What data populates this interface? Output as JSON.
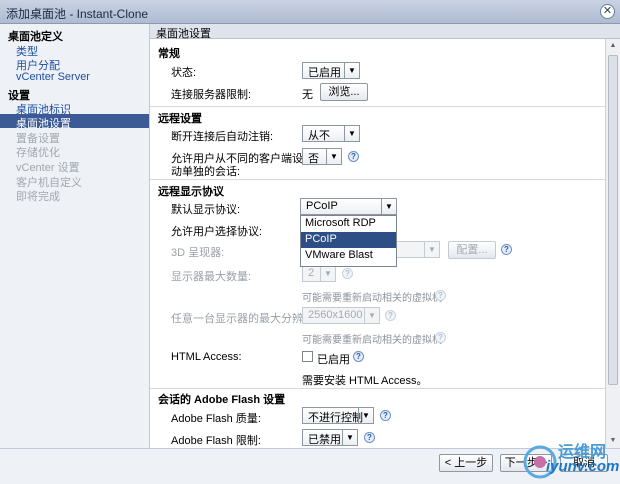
{
  "window": {
    "title": "添加桌面池 - Instant-Clone",
    "close_glyph": "✕"
  },
  "nav": {
    "group1": "桌面池定义",
    "type": "类型",
    "user_assignment": "用户分配",
    "vcenter_server": "vCenter Server",
    "group2": "设置",
    "pool_id": "桌面池标识",
    "pool_settings": "桌面池设置",
    "provisioning": "置备设置",
    "storage_opt": "存储优化",
    "vcenter_settings": "vCenter 设置",
    "guest_custom": "客户机自定义",
    "ready": "即将完成"
  },
  "pane": {
    "title": "桌面池设置",
    "general": {
      "heading": "常规",
      "state_label": "状态:",
      "state_value": "已启用",
      "conn_label": "连接服务器限制:",
      "conn_value": "无",
      "browse": "浏览..."
    },
    "remote": {
      "heading": "远程设置",
      "logoff_label": "断开连接后自动注销:",
      "logoff_value": "从不",
      "multi_label_1": "允许用户从不同的客户端设备启",
      "multi_label_2": "动单独的会话:",
      "multi_value": "否"
    },
    "display": {
      "heading": "远程显示协议",
      "default_label": "默认显示协议:",
      "default_value": "PCoIP",
      "allow_label": "允许用户选择协议:",
      "renderer_label": "3D 呈现器:",
      "configure": "配置...",
      "max_monitors_label": "显示器最大数量:",
      "max_monitors_value": "2",
      "restart_note": "可能需要重新启动相关的虚拟机",
      "max_res_label": "任意一台显示器的最大分辨率:",
      "max_res_value": "2560x1600",
      "html_label": "HTML Access:",
      "html_check_label": "已启用",
      "html_note": "需要安装 HTML Access。"
    },
    "flash": {
      "heading": "会话的 Adobe Flash 设置",
      "quality_label": "Adobe Flash 质量:",
      "quality_value": "不进行控制",
      "throttle_label": "Adobe Flash 限制:",
      "throttle_value": "已禁用"
    },
    "protocol_options": [
      "Microsoft RDP",
      "PCoIP",
      "VMware Blast"
    ]
  },
  "footer": {
    "back": "< 上一步",
    "next": "下一步 >",
    "cancel": "取消"
  },
  "watermark": {
    "brand": "运维网",
    "site": "iyunv.com"
  },
  "glyphs": {
    "help": "?",
    "arrow": "▼",
    "up": "▲",
    "down": "▼"
  }
}
